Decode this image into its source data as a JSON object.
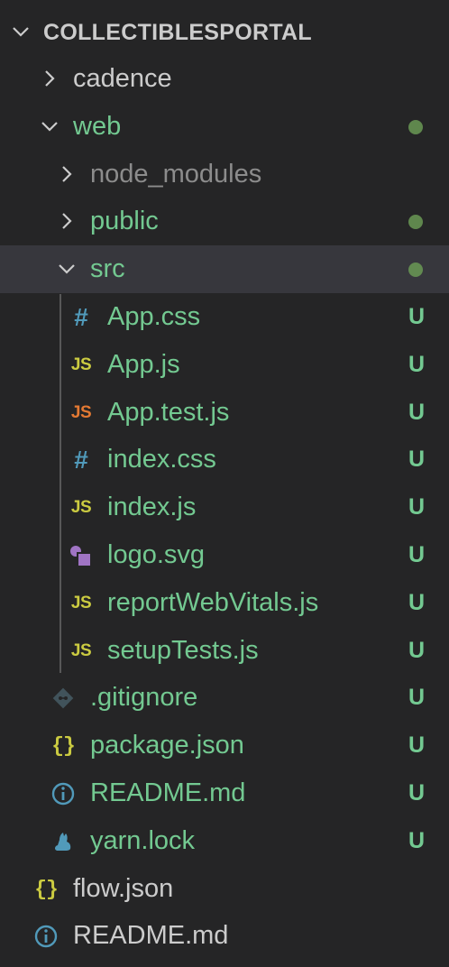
{
  "explorer": {
    "root": {
      "title": "COLLECTIBLESPORTAL"
    },
    "colors": {
      "default_text": "#cccccc",
      "untracked_green": "#73c991",
      "ignored_gray": "#8c8c8c",
      "selected_bg": "#37373d",
      "background": "#252526"
    },
    "items": [
      {
        "label": "cadence",
        "type": "folder",
        "expanded": false,
        "git": ""
      },
      {
        "label": "web",
        "type": "folder",
        "expanded": true,
        "git": "dot"
      },
      {
        "label": "node_modules",
        "type": "folder",
        "expanded": false,
        "git": "ignored"
      },
      {
        "label": "public",
        "type": "folder",
        "expanded": false,
        "git": "dot"
      },
      {
        "label": "src",
        "type": "folder",
        "expanded": true,
        "git": "dot",
        "selected": true
      },
      {
        "label": "App.css",
        "type": "file",
        "icon": "css-hash-icon",
        "status": "U"
      },
      {
        "label": "App.js",
        "type": "file",
        "icon": "js-icon",
        "status": "U"
      },
      {
        "label": "App.test.js",
        "type": "file",
        "icon": "js-test-icon",
        "status": "U"
      },
      {
        "label": "index.css",
        "type": "file",
        "icon": "css-hash-icon",
        "status": "U"
      },
      {
        "label": "index.js",
        "type": "file",
        "icon": "js-icon",
        "status": "U"
      },
      {
        "label": "logo.svg",
        "type": "file",
        "icon": "svg-shapes-icon",
        "status": "U"
      },
      {
        "label": "reportWebVitals.js",
        "type": "file",
        "icon": "js-icon",
        "status": "U"
      },
      {
        "label": "setupTests.js",
        "type": "file",
        "icon": "js-icon",
        "status": "U"
      },
      {
        "label": ".gitignore",
        "type": "file",
        "icon": "git-icon",
        "status": "U"
      },
      {
        "label": "package.json",
        "type": "file",
        "icon": "json-braces-icon",
        "status": "U"
      },
      {
        "label": "README.md",
        "type": "file",
        "icon": "info-icon",
        "status": "U"
      },
      {
        "label": "yarn.lock",
        "type": "file",
        "icon": "yarn-cat-icon",
        "status": "U"
      },
      {
        "label": "flow.json",
        "type": "file",
        "icon": "json-braces-icon",
        "status": ""
      },
      {
        "label": "README.md",
        "type": "file",
        "icon": "info-icon",
        "status": ""
      }
    ]
  }
}
